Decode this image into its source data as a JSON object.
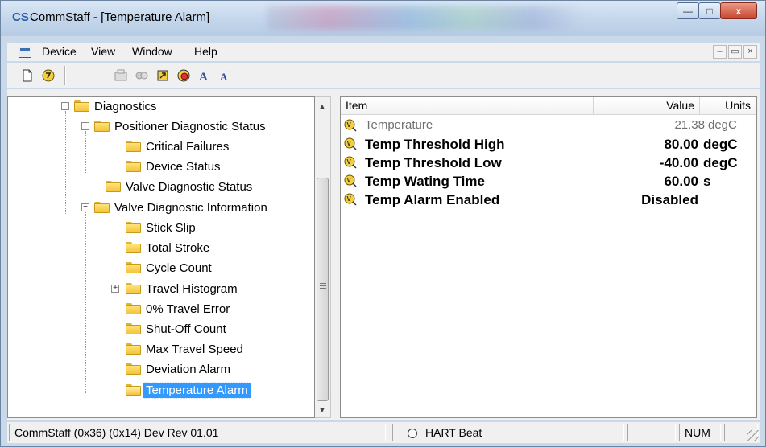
{
  "window": {
    "title": "CommStaff - [Temperature Alarm]",
    "app_icon": "CS",
    "caption_buttons": {
      "minimize": "—",
      "maximize": "□",
      "close": "x"
    }
  },
  "menu": {
    "items": [
      "Device",
      "View",
      "Window",
      "Help"
    ],
    "mdi_buttons": [
      "–",
      "▭",
      "×"
    ]
  },
  "toolbar": {
    "buttons": [
      {
        "icon": "new-document-icon"
      },
      {
        "icon": "open-device-icon"
      },
      {
        "icon": "device-properties-icon"
      },
      {
        "icon": "device-compare-icon"
      },
      {
        "icon": "refresh-tree-icon"
      },
      {
        "icon": "stop-device-icon"
      },
      {
        "icon": "font-increase-icon"
      },
      {
        "icon": "font-decrease-icon"
      }
    ]
  },
  "tree": {
    "nodes": [
      {
        "label": "Diagnostics"
      },
      {
        "label": "Positioner Diagnostic Status"
      },
      {
        "label": "Critical Failures"
      },
      {
        "label": "Device Status"
      },
      {
        "label": "Valve Diagnostic Status"
      },
      {
        "label": "Valve Diagnostic Information"
      },
      {
        "label": "Stick Slip"
      },
      {
        "label": "Total Stroke"
      },
      {
        "label": "Cycle Count"
      },
      {
        "label": "Travel Histogram"
      },
      {
        "label": "0% Travel Error"
      },
      {
        "label": "Shut-Off Count"
      },
      {
        "label": "Max Travel Speed"
      },
      {
        "label": "Deviation Alarm"
      },
      {
        "label": "Temperature Alarm"
      }
    ],
    "selected": "Temperature Alarm"
  },
  "list": {
    "headers": {
      "item": "Item",
      "value": "Value",
      "units": "Units"
    },
    "rows": [
      {
        "item": "Temperature",
        "value": "21.38",
        "units": "degC"
      },
      {
        "item": "Temp Threshold High",
        "value": "80.00",
        "units": "degC"
      },
      {
        "item": "Temp Threshold Low",
        "value": "-40.00",
        "units": "degC"
      },
      {
        "item": "Temp Wating Time",
        "value": "60.00",
        "units": "s"
      },
      {
        "item": "Temp Alarm Enabled",
        "value": "Disabled",
        "units": ""
      }
    ]
  },
  "status": {
    "device_info": "CommStaff  (0x36)  (0x14) Dev Rev 01.01",
    "hart": "HART Beat",
    "num": "NUM"
  },
  "colors": {
    "selection": "#3399ff",
    "folder": "#f3c43a",
    "titlebar": "#c5d7ec"
  }
}
